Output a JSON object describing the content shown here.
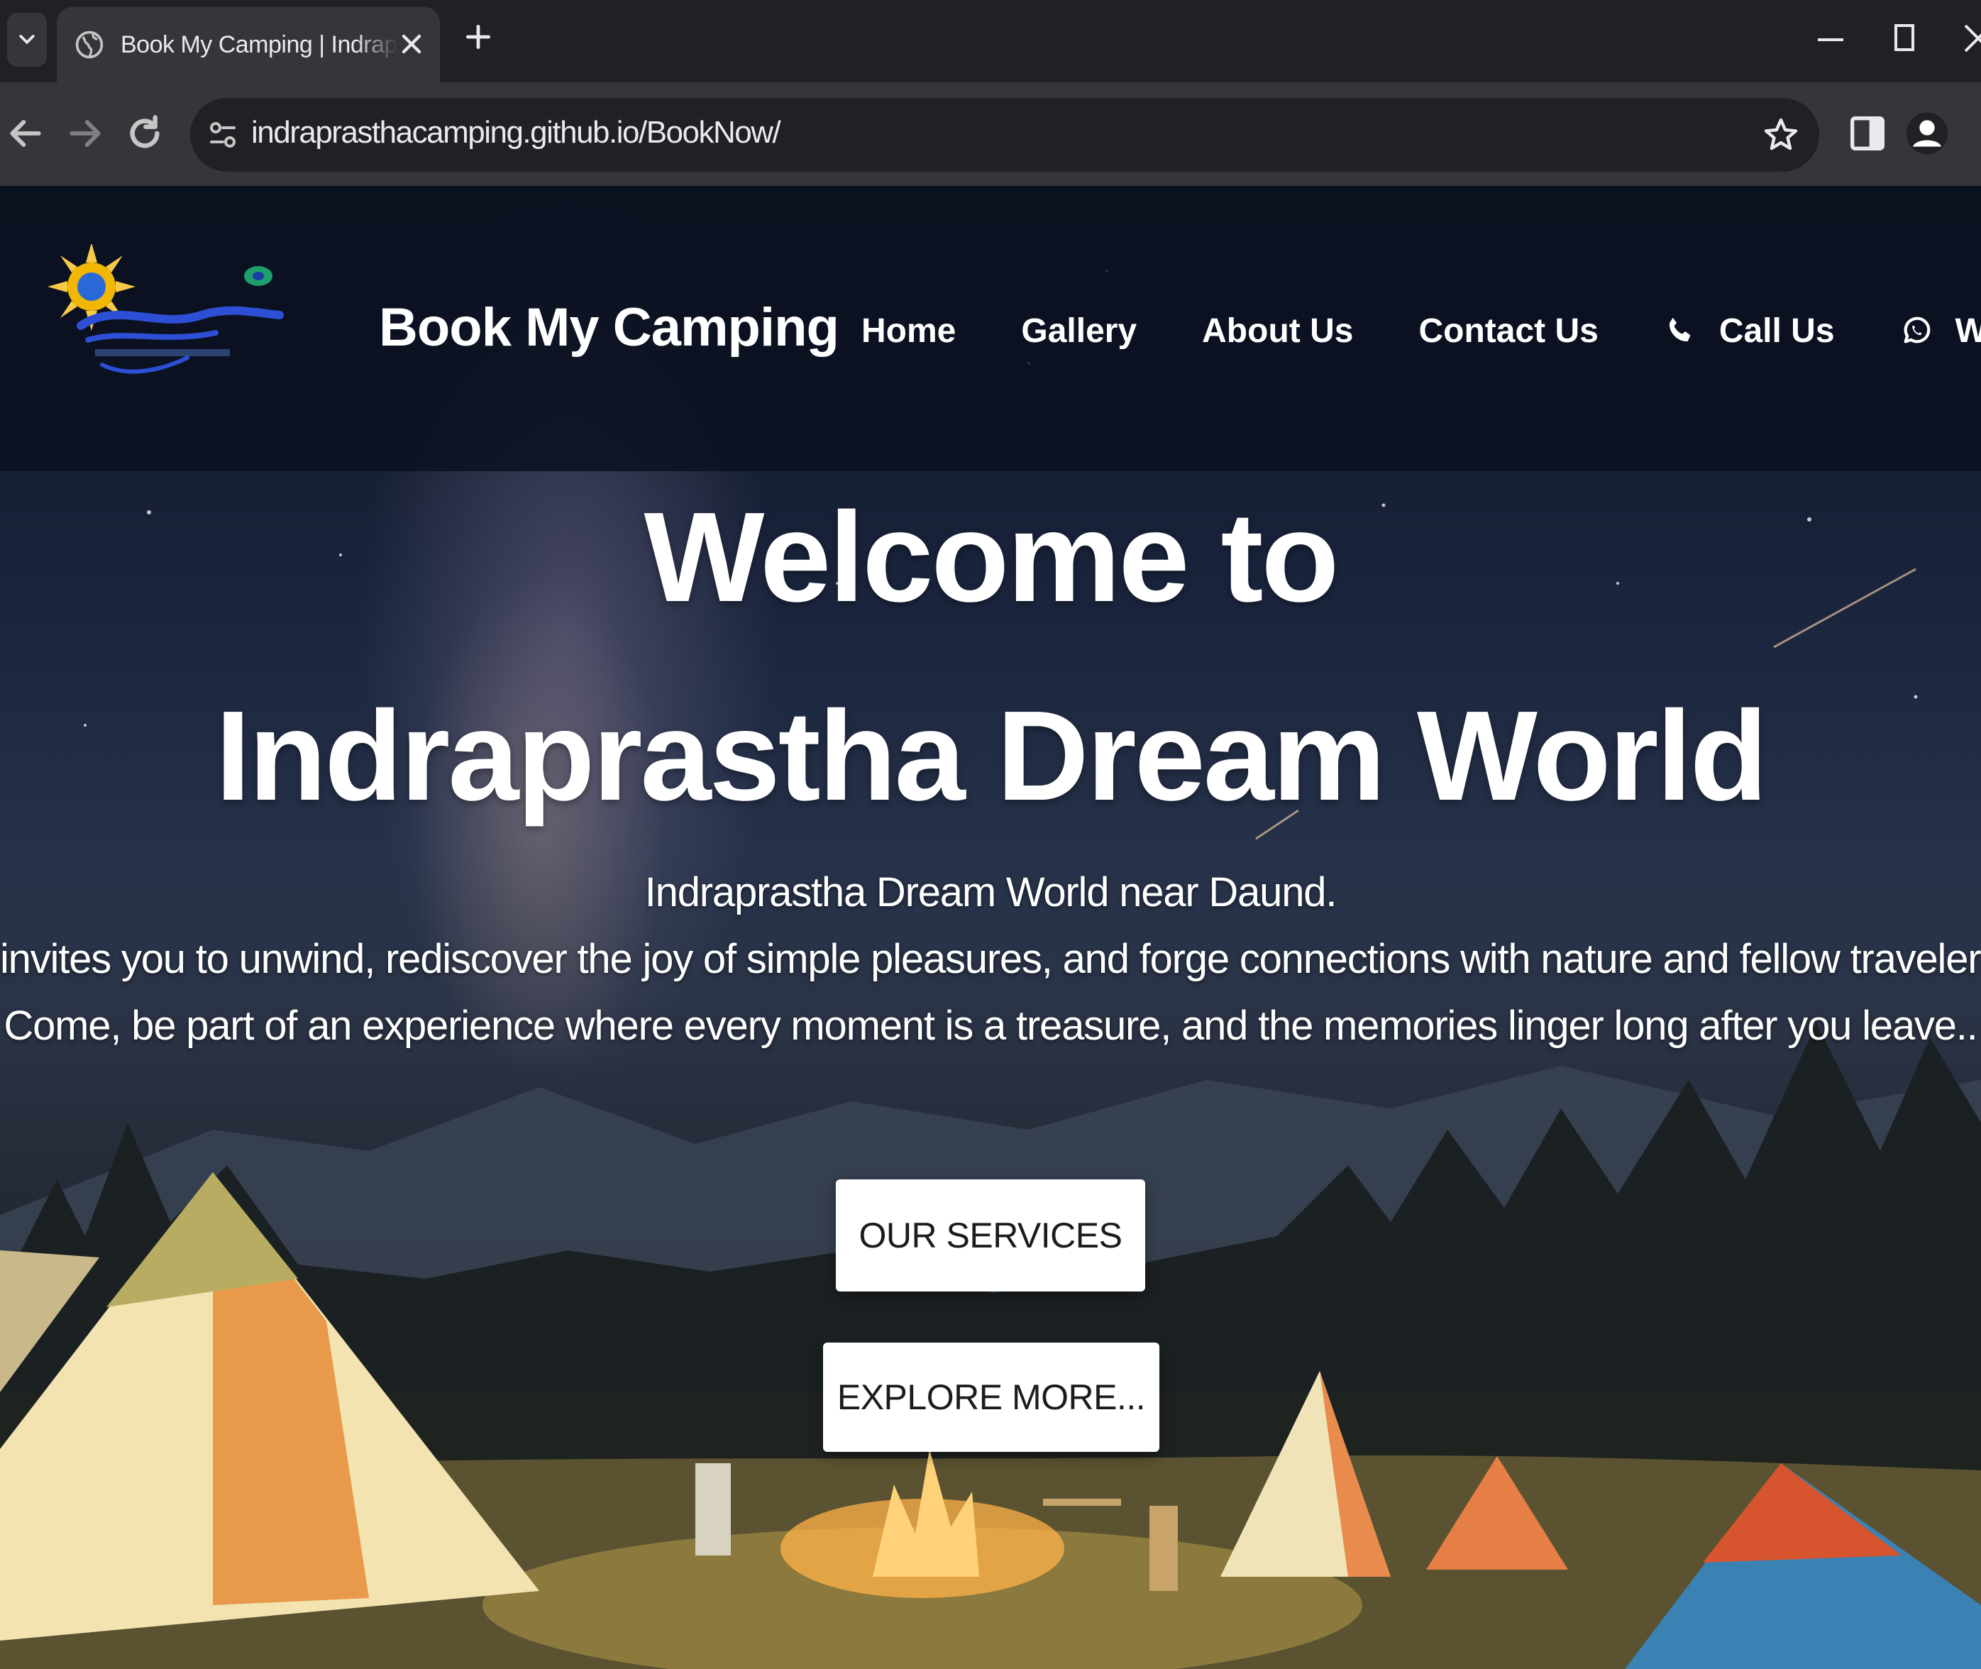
{
  "browser": {
    "tab_title": "Book My Camping | Indraprastha",
    "url": "indraprasthacamping.github.io/BookNow/"
  },
  "header": {
    "brand": "Book My Camping",
    "nav": {
      "home": "Home",
      "gallery": "Gallery",
      "about": "About Us",
      "contact": "Contact Us",
      "call": "Call Us",
      "whatsapp": "Whatsapp"
    }
  },
  "hero": {
    "title_line1": "Welcome to",
    "title_line2": "Indraprastha Dream World",
    "subtitle_line1": "Indraprastha Dream World near Daund.",
    "subtitle_line2": "invites you to unwind, rediscover the joy of simple pleasures, and forge connections with nature and fellow travelers.",
    "subtitle_line3": "Come, be part of an experience where every moment is a treasure, and the memories linger long after you leave..",
    "buttons": {
      "services": "OUR SERVICES",
      "explore": "EXPLORE MORE..."
    }
  },
  "colors": {
    "header_bg": "#0a101e",
    "text": "#ffffff",
    "button_bg": "#ffffff",
    "chrome_bg": "#202124"
  },
  "icons": {
    "call": "phone-icon",
    "whatsapp": "whatsapp-icon"
  }
}
